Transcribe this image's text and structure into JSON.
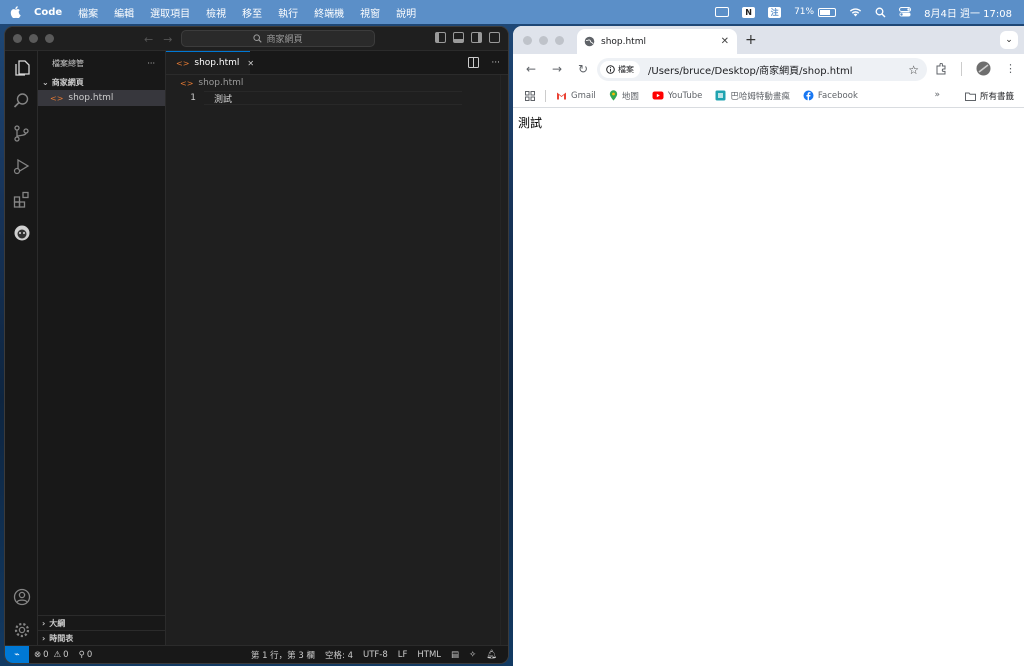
{
  "menubar": {
    "app_name": "Code",
    "items": [
      "檔案",
      "編輯",
      "選取項目",
      "檢視",
      "移至",
      "執行",
      "終端機",
      "視窗",
      "說明"
    ],
    "input_method": "注",
    "battery_percent": "71%",
    "battery_level": 0.71,
    "datetime": "8月4日 週一  17:08"
  },
  "vscode": {
    "search_placeholder": "商家網頁",
    "sidebar_title": "檔案總管",
    "sidebar_more": "···",
    "folder_name": "商家網頁",
    "files": [
      "shop.html"
    ],
    "outline_label": "大綱",
    "timeline_label": "時間表",
    "tab_label": "shop.html",
    "tab_close": "✕",
    "breadcrumb": "shop.html",
    "code_lines": [
      {
        "number": "1",
        "text": "測試"
      }
    ],
    "status": {
      "errors": "0",
      "warnings": "0",
      "ports": "0",
      "position": "第 1 行，第 3 欄",
      "spaces": "空格: 4",
      "encoding": "UTF-8",
      "eol": "LF",
      "language": "HTML"
    },
    "accent_color": "#0078d4"
  },
  "chrome": {
    "tab_title": "shop.html",
    "new_tab": "+",
    "security_chip": "檔案",
    "url": "/Users/bruce/Desktop/商家網頁/shop.html",
    "bookmarks": [
      {
        "label": "Gmail",
        "icon": "gmail-icon"
      },
      {
        "label": "地圖",
        "icon": "maps-icon"
      },
      {
        "label": "YouTube",
        "icon": "youtube-icon"
      },
      {
        "label": "巴哈姆特動畫瘋",
        "icon": "bahamut-icon"
      },
      {
        "label": "Facebook",
        "icon": "facebook-icon"
      }
    ],
    "bookmarks_more": "»",
    "all_bookmarks": "所有書籤",
    "page_text": "測試"
  }
}
